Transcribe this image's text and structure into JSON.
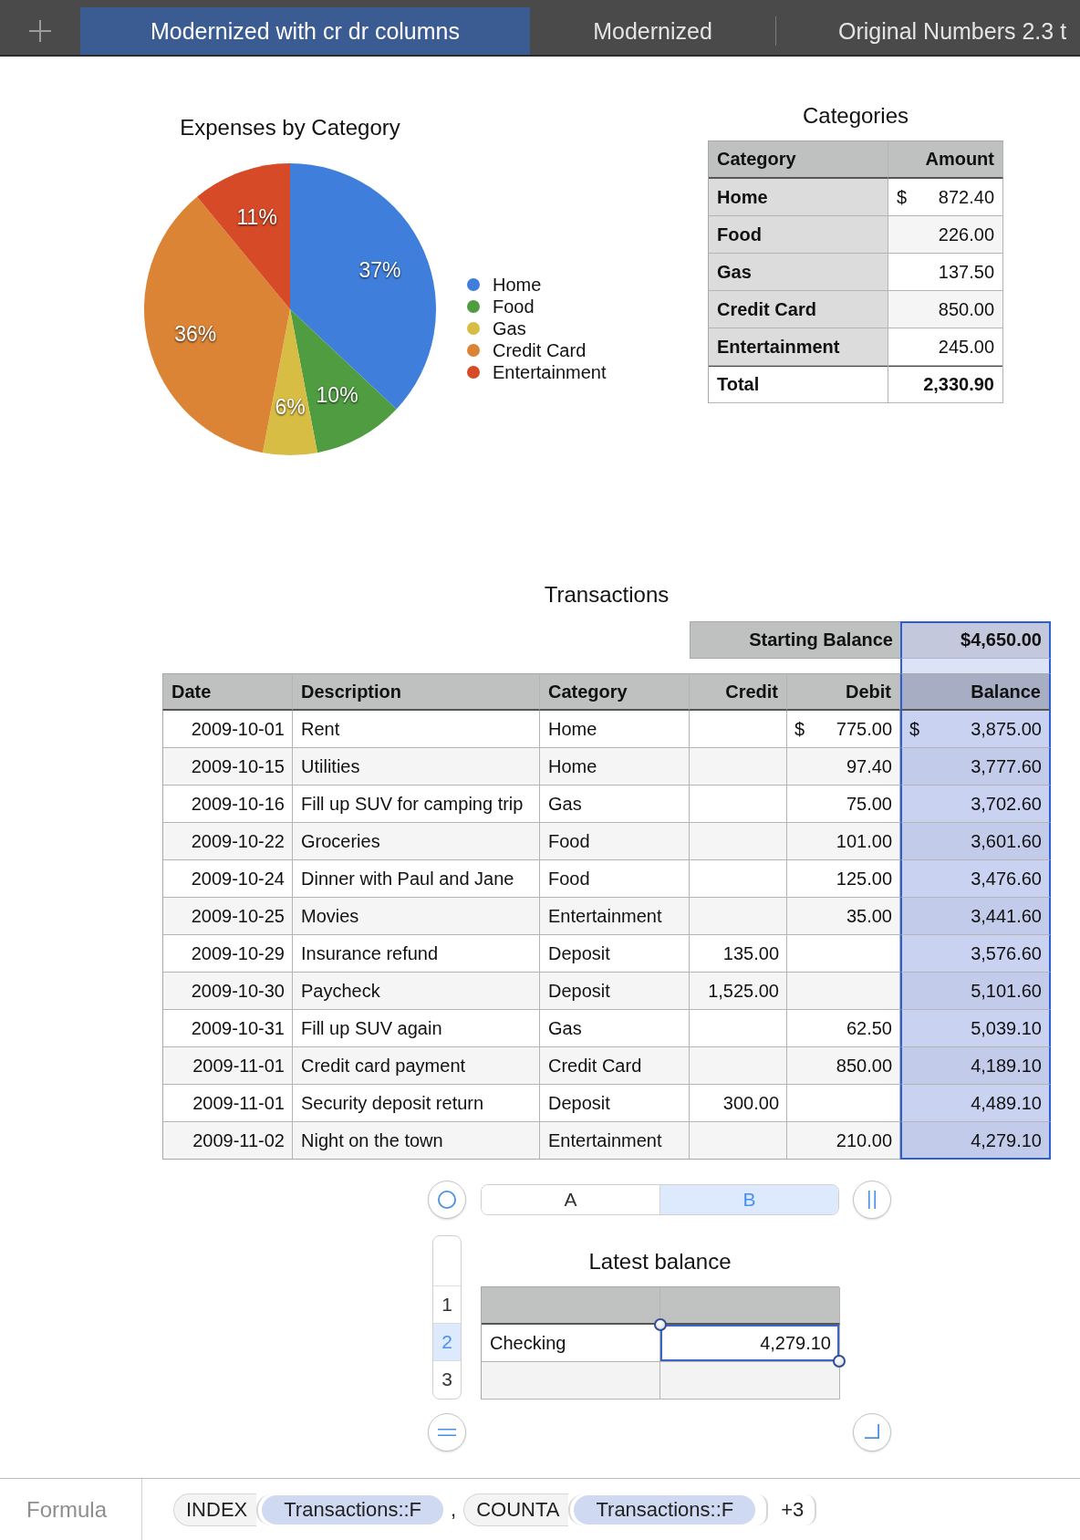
{
  "tab_bar": {
    "tabs": [
      {
        "label": "Modernized with cr dr columns",
        "selected": true
      },
      {
        "label": "Modernized",
        "selected": false
      },
      {
        "label": "Original Numbers 2.3 t",
        "selected": false
      }
    ]
  },
  "expenses_chart": {
    "chart_data": {
      "type": "pie",
      "title": "Expenses by Category",
      "categories": [
        "Home",
        "Food",
        "Gas",
        "Credit Card",
        "Entertainment"
      ],
      "values": [
        37,
        10,
        6,
        36,
        11
      ],
      "colors": [
        "#3f7fdb",
        "#4f9d40",
        "#d8bd44",
        "#db8436",
        "#d64a27"
      ],
      "legend": "right",
      "data_labels": true,
      "value_labels": [
        "37%",
        "10%",
        "6%",
        "36%",
        "11%"
      ]
    }
  },
  "categories_table": {
    "title": "Categories",
    "columns": [
      "Category",
      "Amount"
    ],
    "rows": [
      {
        "category": "Home",
        "currency": "$",
        "amount": "872.40"
      },
      {
        "category": "Food",
        "amount": "226.00"
      },
      {
        "category": "Gas",
        "amount": "137.50"
      },
      {
        "category": "Credit Card",
        "amount": "850.00"
      },
      {
        "category": "Entertainment",
        "amount": "245.00"
      }
    ],
    "total": {
      "label": "Total",
      "amount": "2,330.90"
    }
  },
  "transactions_table": {
    "title": "Transactions",
    "starting_balance": {
      "label": "Starting Balance",
      "value": "$4,650.00"
    },
    "columns": [
      {
        "label": "Date",
        "kind": "date",
        "selected": false
      },
      {
        "label": "Description",
        "kind": "text",
        "selected": false
      },
      {
        "label": "Category",
        "kind": "text",
        "selected": false
      },
      {
        "label": "Credit",
        "kind": "money",
        "selected": false
      },
      {
        "label": "Debit",
        "kind": "money",
        "selected": false
      },
      {
        "label": "Balance",
        "kind": "money",
        "selected": true
      }
    ],
    "rows": [
      {
        "cells": [
          "2009-10-01",
          "Rent",
          "Home",
          null,
          {
            "currency": "$",
            "amount": "775.00"
          },
          {
            "currency": "$",
            "amount": "3,875.00"
          }
        ]
      },
      {
        "cells": [
          "2009-10-15",
          "Utilities",
          "Home",
          null,
          "97.40",
          "3,777.60"
        ]
      },
      {
        "cells": [
          "2009-10-16",
          "Fill up SUV for camping trip",
          "Gas",
          null,
          "75.00",
          "3,702.60"
        ]
      },
      {
        "cells": [
          "2009-10-22",
          "Groceries",
          "Food",
          null,
          "101.00",
          "3,601.60"
        ]
      },
      {
        "cells": [
          "2009-10-24",
          "Dinner with Paul and Jane",
          "Food",
          null,
          "125.00",
          "3,476.60"
        ]
      },
      {
        "cells": [
          "2009-10-25",
          "Movies",
          "Entertainment",
          null,
          "35.00",
          "3,441.60"
        ]
      },
      {
        "cells": [
          "2009-10-29",
          "Insurance refund",
          "Deposit",
          "135.00",
          null,
          "3,576.60"
        ]
      },
      {
        "cells": [
          "2009-10-30",
          "Paycheck",
          "Deposit",
          "1,525.00",
          null,
          "5,101.60"
        ]
      },
      {
        "cells": [
          "2009-10-31",
          "Fill up SUV again",
          "Gas",
          null,
          "62.50",
          "5,039.10"
        ]
      },
      {
        "cells": [
          "2009-11-01",
          "Credit card payment",
          "Credit Card",
          null,
          "850.00",
          "4,189.10"
        ]
      },
      {
        "cells": [
          "2009-11-01",
          "Security deposit return",
          "Deposit",
          "300.00",
          null,
          "4,489.10"
        ]
      },
      {
        "cells": [
          "2009-11-02",
          "Night on the town",
          "Entertainment",
          null,
          "210.00",
          "4,279.10"
        ]
      }
    ]
  },
  "balance_table": {
    "title": "Latest balance",
    "column_headers": [
      {
        "label": "A",
        "selected": false
      },
      {
        "label": "B",
        "selected": true
      }
    ],
    "row_headers": [
      {
        "label": "1",
        "selected": false
      },
      {
        "label": "2",
        "selected": true
      },
      {
        "label": "3",
        "selected": false
      }
    ],
    "rows": [
      {
        "kind": "header"
      },
      {
        "kind": "body",
        "cells": [
          {
            "text": "Checking",
            "kind": "text",
            "selected": false
          },
          {
            "text": "4,279.10",
            "kind": "number",
            "selected": true
          }
        ]
      },
      {
        "kind": "body"
      }
    ]
  },
  "formula_bar": {
    "label": "Formula",
    "expression": [
      {
        "kind": "function",
        "name": "INDEX",
        "args": [
          {
            "kind": "reference",
            "text": "Transactions::F"
          },
          {
            "kind": "separator",
            "text": ","
          },
          {
            "kind": "function",
            "name": "COUNTA",
            "args": [
              {
                "kind": "reference",
                "text": "Transactions::F"
              }
            ]
          },
          {
            "kind": "operator",
            "text": "+3"
          }
        ]
      }
    ]
  }
}
